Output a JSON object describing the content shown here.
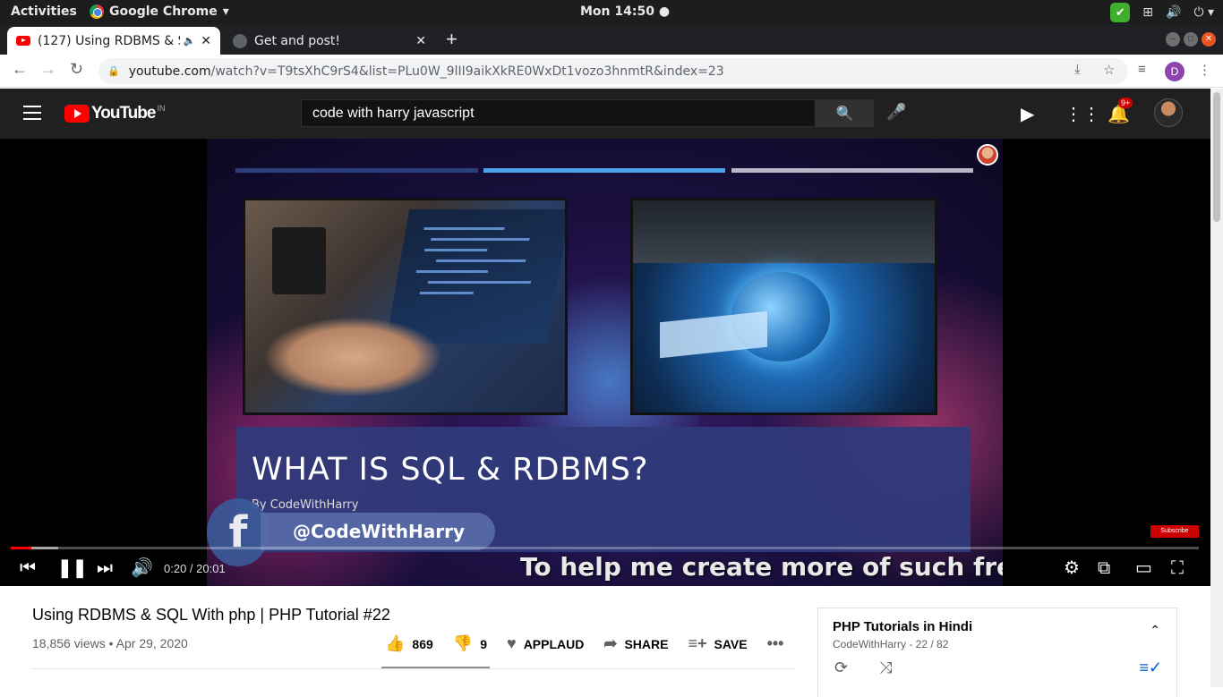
{
  "os": {
    "activities": "Activities",
    "app_name": "Google Chrome",
    "clock": "Mon 14:50"
  },
  "tabs": [
    {
      "title": "(127) Using RDBMS & S",
      "active": true,
      "audio": true
    },
    {
      "title": "Get and post!",
      "active": false
    }
  ],
  "omnibox": {
    "host": "youtube.com",
    "path": "/watch?v=T9tsXhC9rS4&list=PLu0W_9lII9aikXkRE0WxDt1vozo3hnmtR&index=23"
  },
  "profile_initial": "D",
  "youtube": {
    "logo_text": "YouTube",
    "country": "IN",
    "search_value": "code with harry javascript",
    "notification_badge": "9+"
  },
  "video": {
    "slide_title": "WHAT IS SQL & RDBMS?",
    "slide_by": "By CodeWithHarry",
    "fb_handle": "@CodeWithHarry",
    "overlay_text": "To help me create more of such free",
    "subscribe_badge": "Subscribe",
    "current_time": "0:20",
    "duration": "20:01",
    "progress_fraction": 0.017,
    "buffer_fraction": 0.04
  },
  "details": {
    "title": "Using RDBMS & SQL With php | PHP Tutorial #22",
    "views": "18,856 views",
    "date": "Apr 29, 2020",
    "likes": "869",
    "dislikes": "9",
    "applaud": "APPLAUD",
    "share": "SHARE",
    "save": "SAVE"
  },
  "playlist": {
    "title": "PHP Tutorials in Hindi",
    "channel_position": "CodeWithHarry - 22 / 82"
  },
  "colors": {
    "yt_red": "#ff0000",
    "yt_header": "#202020",
    "ubuntu_orange": "#e95420"
  }
}
